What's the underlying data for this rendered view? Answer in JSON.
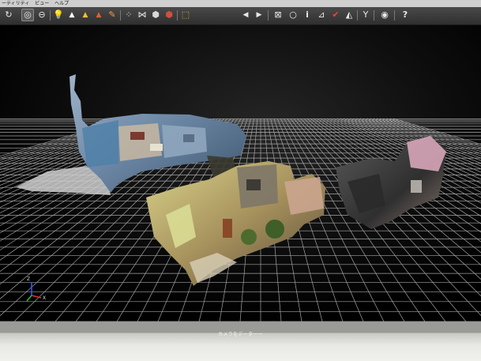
{
  "menu": {
    "items": [
      "ーティリティ",
      "ビュー",
      "ヘルプ"
    ]
  },
  "toolbar": {
    "tools": [
      {
        "name": "rotate-icon",
        "glyph": "↻"
      },
      {
        "name": "orbit-icon",
        "glyph": "◎"
      },
      {
        "name": "pan-icon",
        "glyph": "⊖"
      },
      {
        "name": "light-icon",
        "glyph": "💡"
      },
      {
        "name": "mesh-icon",
        "glyph": "▲"
      },
      {
        "name": "warning-icon",
        "glyph": "▲"
      },
      {
        "name": "color-icon",
        "glyph": "▲"
      },
      {
        "name": "brush-icon",
        "glyph": "✎"
      },
      {
        "name": "points-icon",
        "glyph": "⁘"
      },
      {
        "name": "wire-icon",
        "glyph": "⋈"
      },
      {
        "name": "solid-icon",
        "glyph": "⬢"
      },
      {
        "name": "texture-icon",
        "glyph": "⬢"
      },
      {
        "name": "fit-view-icon",
        "glyph": "⬚"
      },
      {
        "name": "undo-icon",
        "glyph": "◀"
      },
      {
        "name": "redo-icon",
        "glyph": "▶"
      },
      {
        "name": "select-icon",
        "glyph": "⊠"
      },
      {
        "name": "lasso-icon",
        "glyph": "○"
      },
      {
        "name": "pin-icon",
        "glyph": "i"
      },
      {
        "name": "measure-icon",
        "glyph": "⊿"
      },
      {
        "name": "paint-icon",
        "glyph": "✔"
      },
      {
        "name": "gradient-icon",
        "glyph": "◭"
      },
      {
        "name": "tool-icon",
        "glyph": "Y"
      },
      {
        "name": "vr-icon",
        "glyph": "◉"
      },
      {
        "name": "help-icon",
        "glyph": "?"
      }
    ]
  },
  "status": {
    "message": "カメラをデーターー"
  },
  "axis": {
    "z": "Z",
    "x": "X"
  },
  "colors": {
    "toolbar_bg": "#3a3a3a",
    "viewport_bg": "#000000",
    "grid": "#bfbfbf"
  }
}
